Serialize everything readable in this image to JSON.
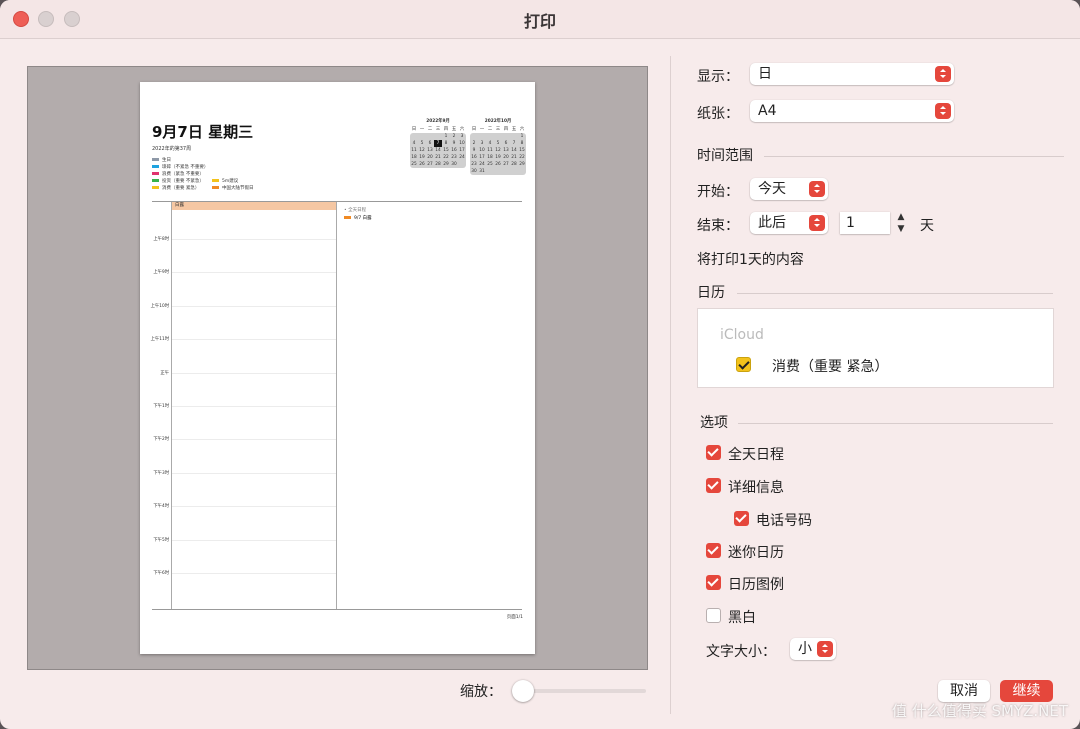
{
  "window": {
    "title": "打印"
  },
  "preview": {
    "date_title": "9月7日 星期三",
    "week_info": "2022年的第37周",
    "legend": [
      {
        "label": "生日",
        "color": "#8e99a8"
      },
      {
        "label": "琐碎（不紧急 不重要）",
        "color": "#1fa3e0"
      },
      {
        "label": "浪费（紧急 不重要）",
        "color": "#e0336e"
      },
      {
        "label": "投资（重要 不紧急）",
        "color": "#37b24a"
      },
      {
        "label": "5m建议",
        "color": "#f3c21b"
      },
      {
        "label": "消费（重要 紧急）",
        "color": "#f3c21b"
      },
      {
        "label": "中国大陆节假日",
        "color": "#f08a24"
      }
    ],
    "mini_cal_sep": {
      "title": "2022年9月",
      "headers": [
        "日",
        "一",
        "二",
        "三",
        "四",
        "五",
        "六"
      ],
      "days": [
        "",
        "",
        "",
        "",
        "1",
        "2",
        "3",
        "4",
        "5",
        "6",
        "7",
        "8",
        "9",
        "10",
        "11",
        "12",
        "13",
        "14",
        "15",
        "16",
        "17",
        "18",
        "19",
        "20",
        "21",
        "22",
        "23",
        "24",
        "25",
        "26",
        "27",
        "28",
        "29",
        "30",
        ""
      ],
      "selected": "7"
    },
    "mini_cal_oct": {
      "title": "2022年10月",
      "headers": [
        "日",
        "一",
        "二",
        "三",
        "四",
        "五",
        "六"
      ],
      "days": [
        "",
        "",
        "",
        "",
        "",
        "",
        "1",
        "2",
        "3",
        "4",
        "5",
        "6",
        "7",
        "8",
        "9",
        "10",
        "11",
        "12",
        "13",
        "14",
        "15",
        "16",
        "17",
        "18",
        "19",
        "20",
        "21",
        "22",
        "23",
        "24",
        "25",
        "26",
        "27",
        "28",
        "29",
        "30",
        "31",
        "",
        "",
        "",
        "",
        ""
      ]
    },
    "allday_event": "白露",
    "time_labels": [
      "上午8时",
      "上午9时",
      "上午10时",
      "上午11时",
      "正午",
      "下午1时",
      "下午2时",
      "下午3时",
      "下午4时",
      "下午5时",
      "下午6时"
    ],
    "right_col_title": "• 全天日程",
    "right_col_event": "9/7 白露",
    "page_number": "页面1/1"
  },
  "zoom": {
    "label": "缩放：",
    "level": 0
  },
  "settings": {
    "display_label": "显示：",
    "display_value": "日",
    "paper_label": "纸张：",
    "paper_value": "A4",
    "time_range_heading": "时间范围",
    "start_label": "开始：",
    "start_value": "今天",
    "end_label": "结束：",
    "end_value": "此后",
    "days_count": "1",
    "days_unit": "天",
    "summary": "将打印1天的内容",
    "calendar_heading": "日历",
    "calendar_source": "iCloud",
    "calendar_item": "消费（重要 紧急）",
    "options_heading": "选项",
    "options": [
      {
        "label": "全天日程",
        "checked": true
      },
      {
        "label": "详细信息",
        "checked": true
      },
      {
        "label": "电话号码",
        "checked": true
      },
      {
        "label": "迷你日历",
        "checked": true
      },
      {
        "label": "日历图例",
        "checked": true
      },
      {
        "label": "黑白",
        "checked": false
      }
    ],
    "font_size_label": "文字大小：",
    "font_size_value": "小"
  },
  "buttons": {
    "cancel": "取消",
    "continue": "继续"
  },
  "watermark": "值 什么值得买 SMYZ.NET"
}
